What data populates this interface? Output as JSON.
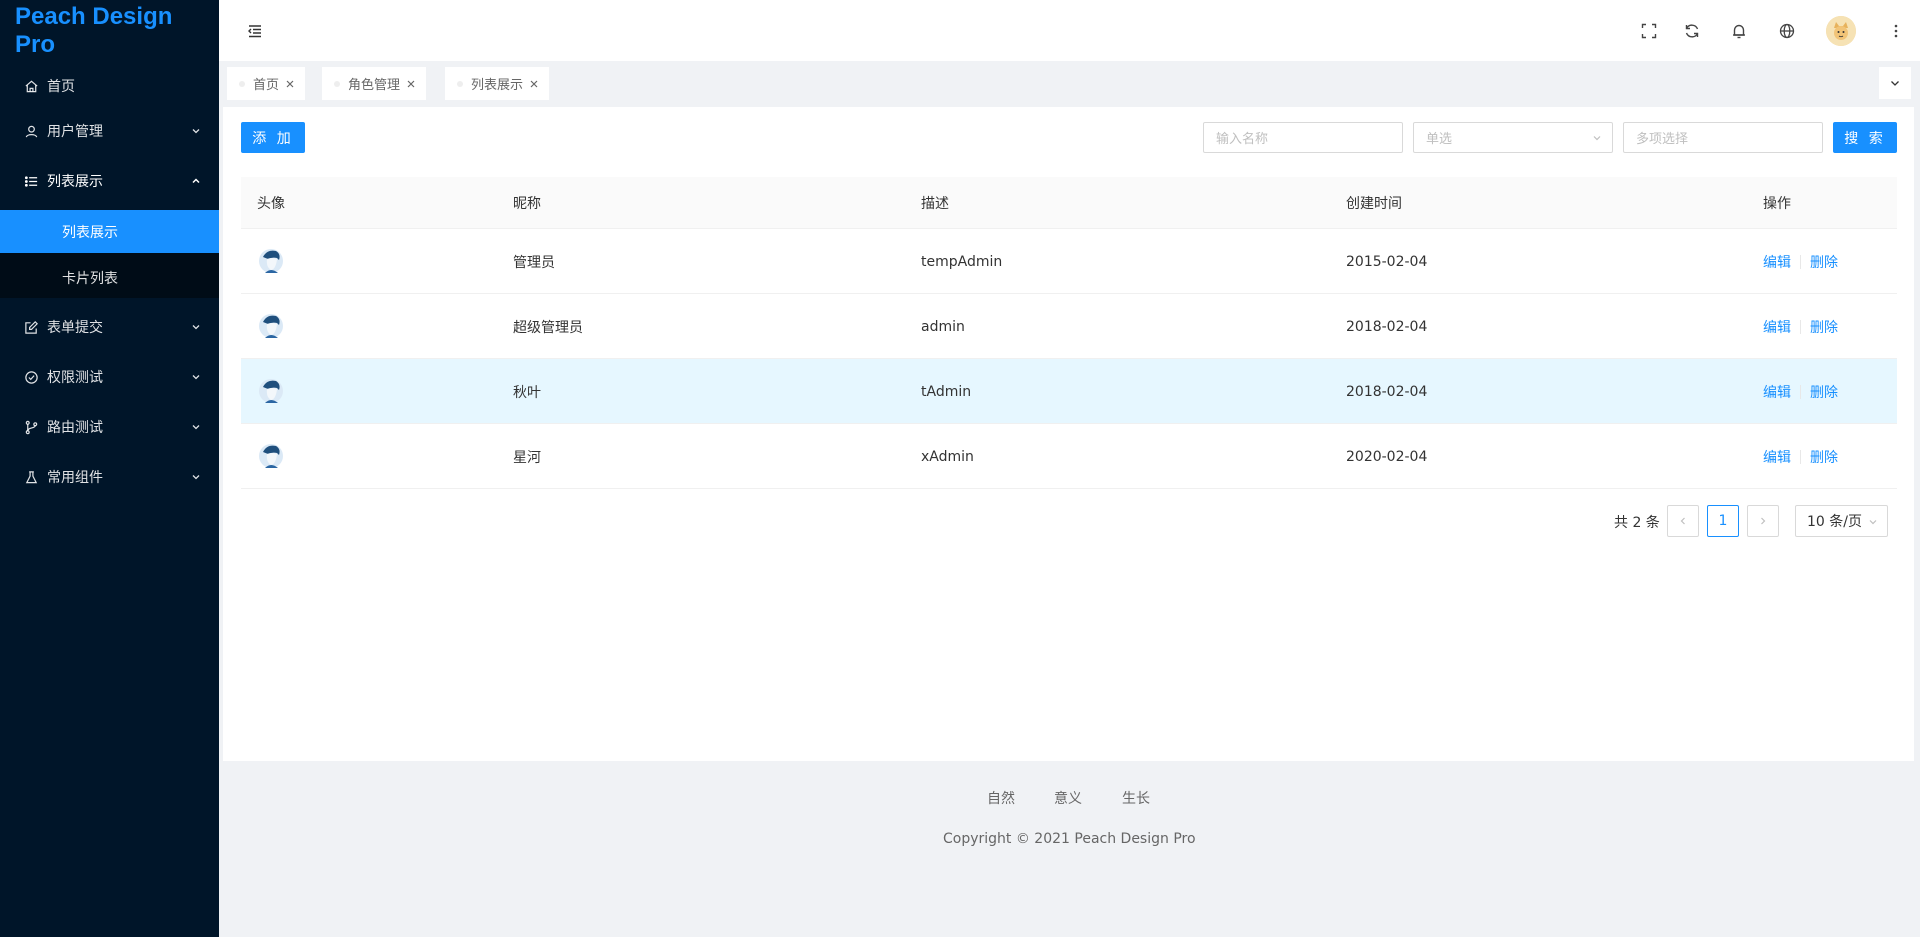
{
  "app": {
    "logo": "Peach Design Pro"
  },
  "sidebar": {
    "items": [
      {
        "label": "首页",
        "icon": "home-icon"
      },
      {
        "label": "用户管理",
        "icon": "user-icon"
      },
      {
        "label": "列表展示",
        "icon": "list-icon"
      },
      {
        "label": "表单提交",
        "icon": "form-icon"
      },
      {
        "label": "权限测试",
        "icon": "check-circle-icon"
      },
      {
        "label": "路由测试",
        "icon": "branch-icon"
      },
      {
        "label": "常用组件",
        "icon": "flask-icon"
      }
    ],
    "submenu": [
      {
        "label": "列表展示",
        "active": true
      },
      {
        "label": "卡片列表",
        "active": false
      }
    ]
  },
  "header": {
    "icons": [
      "menu-fold-icon",
      "fullscreen-icon",
      "reload-icon",
      "bell-icon",
      "globe-icon",
      "avatar",
      "more-vertical-icon"
    ]
  },
  "tabs": [
    {
      "label": "首页"
    },
    {
      "label": "角色管理"
    },
    {
      "label": "列表展示"
    }
  ],
  "toolbar": {
    "add_label": "添 加",
    "name_placeholder": "输入名称",
    "single_placeholder": "单选",
    "multi_placeholder": "多项选择",
    "search_label": "搜 索"
  },
  "table": {
    "columns": [
      "头像",
      "昵称",
      "描述",
      "创建时间",
      "操作"
    ],
    "rows": [
      {
        "nickname": "管理员",
        "desc": "tempAdmin",
        "created": "2015-02-04",
        "edit": "编辑",
        "delete": "删除"
      },
      {
        "nickname": "超级管理员",
        "desc": "admin",
        "created": "2018-02-04",
        "edit": "编辑",
        "delete": "删除"
      },
      {
        "nickname": "秋叶",
        "desc": "tAdmin",
        "created": "2018-02-04",
        "edit": "编辑",
        "delete": "删除"
      },
      {
        "nickname": "星河",
        "desc": "xAdmin",
        "created": "2020-02-04",
        "edit": "编辑",
        "delete": "删除"
      }
    ],
    "highlighted_row": 2
  },
  "pagination": {
    "total_text": "共 2 条",
    "current_page": "1",
    "page_size": "10 条/页"
  },
  "footer": {
    "links": [
      "自然",
      "意义",
      "生长"
    ],
    "copyright": "Copyright © 2021   Peach Design Pro"
  },
  "colors": {
    "primary": "#1890ff",
    "sidebar_bg": "#001529",
    "highlight_row": "#e6f7ff"
  }
}
